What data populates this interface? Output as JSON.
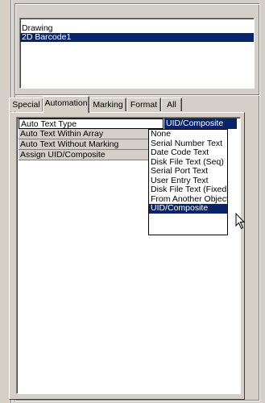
{
  "objects": {
    "items": [
      {
        "label": "Drawing"
      },
      {
        "label": "2D Barcode1"
      }
    ],
    "selected_label": "2D Barcode1"
  },
  "tabs": [
    {
      "label": "Special"
    },
    {
      "label": "Automation"
    },
    {
      "label": "Marking"
    },
    {
      "label": "Format"
    },
    {
      "label": "All"
    }
  ],
  "active_tab": "Automation",
  "properties": [
    {
      "name": "Auto Text Type",
      "value": "UID/Composite"
    },
    {
      "name": "Auto Text Within Array"
    },
    {
      "name": "Auto Text Without Marking"
    },
    {
      "name": "Assign UID/Composite"
    }
  ],
  "dropdown": {
    "options": [
      "None",
      "Serial Number Text",
      "Date Code Text",
      "Disk File Text (Seq)",
      "Serial Port Text",
      "User Entry Text",
      "Disk File Text (Fixed)",
      "From Another Object",
      "UID/Composite"
    ],
    "selected": "UID/Composite"
  },
  "colors": {
    "selection": "#0a246a",
    "face": "#d4d0c8"
  }
}
